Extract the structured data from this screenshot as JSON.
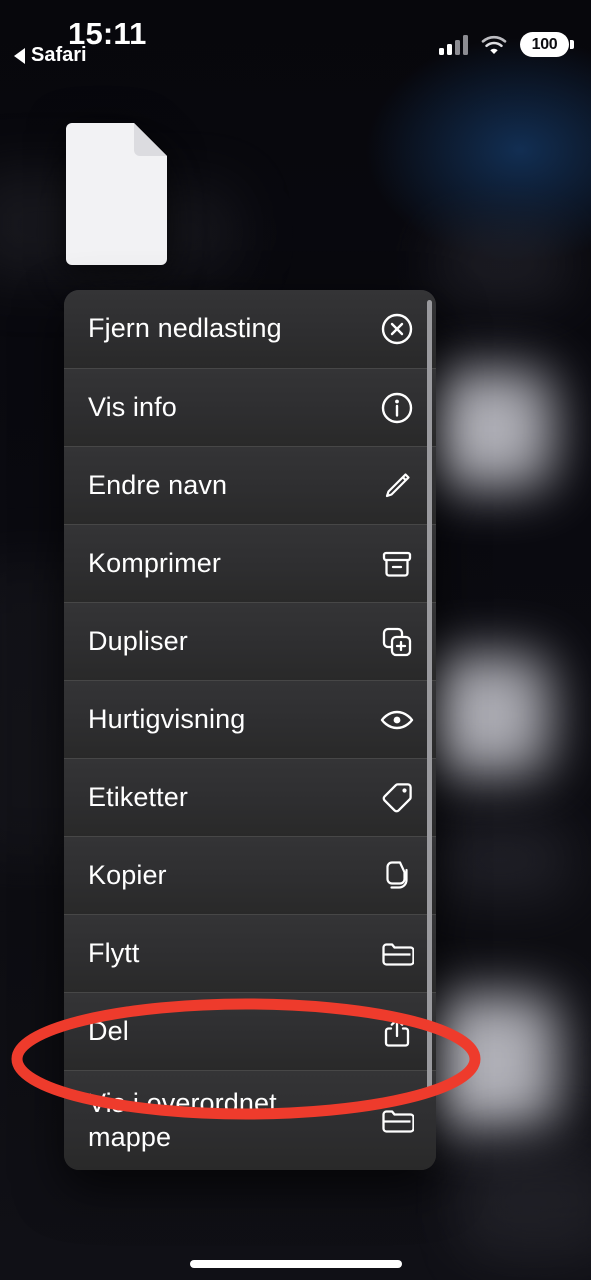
{
  "status_bar": {
    "time": "15:11",
    "back_label": "Safari",
    "back_icon": "triangle-left-icon",
    "signal_icon": "cellular-signal-icon",
    "signal_bars_active": 2,
    "wifi_icon": "wifi-icon",
    "battery_icon": "battery-icon",
    "battery_level": "100"
  },
  "preview": {
    "icon": "document-file-icon",
    "color": "#f2f2f4"
  },
  "menu": {
    "items": [
      {
        "label": "Fjern nedlasting",
        "icon": "x-circle-icon"
      },
      {
        "label": "Vis info",
        "icon": "info-circle-icon"
      },
      {
        "label": "Endre navn",
        "icon": "pencil-icon"
      },
      {
        "label": "Komprimer",
        "icon": "archive-box-icon"
      },
      {
        "label": "Dupliser",
        "icon": "duplicate-plus-icon"
      },
      {
        "label": "Hurtigvisning",
        "icon": "eye-icon"
      },
      {
        "label": "Etiketter",
        "icon": "tag-icon"
      },
      {
        "label": "Kopier",
        "icon": "copy-documents-icon"
      },
      {
        "label": "Flytt",
        "icon": "folder-icon"
      },
      {
        "label": "Del",
        "icon": "share-icon"
      },
      {
        "label": "Vis i overordnet mappe",
        "icon": "folder-icon"
      }
    ],
    "background_color": "#2e2e30",
    "text_color": "#ffffff",
    "scrollbar": "menu-scroll-indicator"
  },
  "annotation": {
    "shape": "ellipse",
    "target_label": "Del",
    "color": "#ee3b2c"
  },
  "home_indicator": {
    "color": "#ffffff"
  }
}
